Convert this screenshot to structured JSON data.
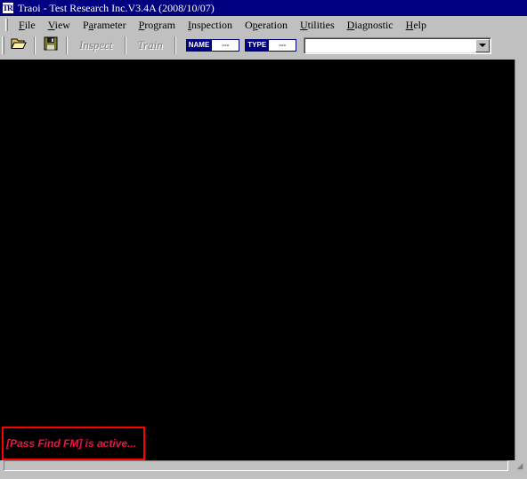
{
  "window": {
    "title": "Traoi - Test Research Inc.V3.4A (2008/10/07)",
    "icon_name": "app-icon",
    "icon_glyph": "TRI",
    "titlebar_color": "#000080",
    "face_color": "#c0c0c0"
  },
  "menu": {
    "items": [
      {
        "label": "File",
        "acc": "F",
        "rest": "ile"
      },
      {
        "label": "View",
        "acc": "V",
        "rest": "iew"
      },
      {
        "label": "Parameter",
        "pre": "P",
        "acc": "a",
        "rest": "rameter"
      },
      {
        "label": "Program",
        "acc": "P",
        "rest": "rogram"
      },
      {
        "label": "Inspection",
        "acc": "I",
        "rest": "nspection"
      },
      {
        "label": "Operation",
        "pre": "O",
        "acc": "p",
        "rest": "eration"
      },
      {
        "label": "Utilities",
        "acc": "U",
        "rest": "tilities"
      },
      {
        "label": "Diagnostic",
        "acc": "D",
        "rest": "iagnostic"
      },
      {
        "label": "Help",
        "acc": "H",
        "rest": "elp"
      }
    ]
  },
  "toolbar": {
    "open_icon": "open-folder-icon",
    "save_icon": "floppy-save-icon",
    "inspect_label": "Inspect",
    "train_label": "Train",
    "inspect_enabled": false,
    "train_enabled": false,
    "name_badge": {
      "key": "NAME",
      "value": "---"
    },
    "type_badge": {
      "key": "TYPE",
      "value": "---"
    },
    "program_combo": {
      "value": "",
      "placeholder": ""
    }
  },
  "canvas": {
    "background": "#000000"
  },
  "alert": {
    "text": "[Pass Find FM] is active...",
    "border_color": "#ff0000",
    "text_color": "#f0104a"
  },
  "status_bar": {
    "text": "",
    "grip": "◢"
  }
}
